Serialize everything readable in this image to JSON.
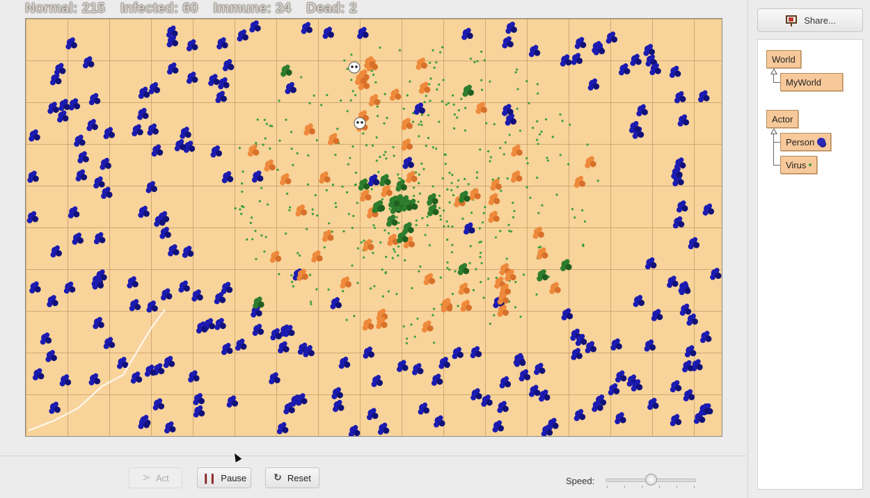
{
  "world": {
    "stats": {
      "normal_label": "Normal:",
      "normal_value": "215",
      "infected_label": "Infected:",
      "infected_value": "60",
      "immune_label": "Immune:",
      "immune_value": "24",
      "dead_label": "Dead:",
      "dead_value": "2"
    },
    "colors": {
      "background": "#f8d39a",
      "normal": "#1b1bb0",
      "infected": "#ee8a3b",
      "immune": "#2e7d2e",
      "virus": "#3aa03a",
      "dead": "#ffffff"
    }
  },
  "controls": {
    "act_label": "Act",
    "pause_label": "Pause",
    "reset_label": "Reset",
    "speed_label": "Speed:",
    "speed_fraction": 0.5
  },
  "side_panel": {
    "share_label": "Share...",
    "classes": {
      "world": "World",
      "myworld": "MyWorld",
      "actor": "Actor",
      "person": "Person",
      "virus": "Virus"
    }
  }
}
